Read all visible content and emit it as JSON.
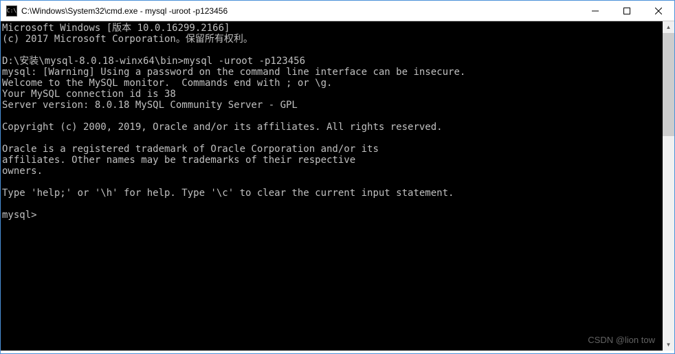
{
  "window": {
    "icon_label": "C:\\",
    "title": "C:\\Windows\\System32\\cmd.exe - mysql  -uroot -p123456"
  },
  "terminal": {
    "lines": [
      "Microsoft Windows [版本 10.0.16299.2166]",
      "(c) 2017 Microsoft Corporation。保留所有权利。",
      "",
      "D:\\安装\\mysql-8.0.18-winx64\\bin>mysql -uroot -p123456",
      "mysql: [Warning] Using a password on the command line interface can be insecure.",
      "Welcome to the MySQL monitor.  Commands end with ; or \\g.",
      "Your MySQL connection id is 38",
      "Server version: 8.0.18 MySQL Community Server - GPL",
      "",
      "Copyright (c) 2000, 2019, Oracle and/or its affiliates. All rights reserved.",
      "",
      "Oracle is a registered trademark of Oracle Corporation and/or its",
      "affiliates. Other names may be trademarks of their respective",
      "owners.",
      "",
      "Type 'help;' or '\\h' for help. Type '\\c' to clear the current input statement.",
      "",
      "mysql>"
    ]
  },
  "watermark": "CSDN @lion tow"
}
